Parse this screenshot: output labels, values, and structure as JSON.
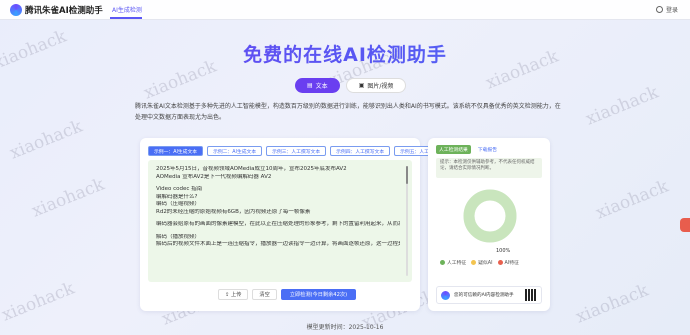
{
  "header": {
    "logo_text": "腾讯朱雀AI检测助手",
    "nav_tab": "AI生成检测",
    "login": "登录"
  },
  "watermark": "xiaohack",
  "page_title": "免费的在线AI检测助手",
  "modes": [
    {
      "label": "文本",
      "active": true
    },
    {
      "label": "图片/视频",
      "active": false
    }
  ],
  "intro": "腾讯朱雀AI文本检测基于多种先进的人工智能模型，构造数百万级别的数据进行训练，能够识别出人类和AI的书写模式。该系统不仅具备优秀的英文检测能力，在处理中文数据方面表现尤为出色。",
  "examples": [
    {
      "label": "示例一：AI生成文本",
      "active": true
    },
    {
      "label": "示例二：AI生成文本",
      "active": false
    },
    {
      "label": "示例三：人工撰写文本",
      "active": false
    },
    {
      "label": "示例四：人工撰写文本",
      "active": false
    },
    {
      "label": "示例五：人工撰写文本",
      "active": false
    }
  ],
  "sample_text": [
    "2025年5月15日，音视频领域AOMedia成立10周年，宣布2025年底发布AV2",
    "AOMedia 宣布AV2是下一代视频编解码器 AV2",
    "",
    "Video codec 指南",
    "编解码器是什么?",
    "编码（压缩视频）",
    "Rd2的未经压缩的原始视频有6GB，因为视频还原了每一帧像素",
    "",
    "编码器会给原有的画面的像素建模型，在此以正在压缩处理的形象参考，剩下的置留利用起来，从而减少存储大小",
    "",
    "解码（播放视频）",
    "解码后的视频文件木面上是一连压缩指令，播放器一边读指令一边计算，将画面逐帧还原，这一过程是解码"
  ],
  "actions": {
    "upload": "上传",
    "clear": "清空",
    "detect": "立即检测(今日剩余42次)"
  },
  "result": {
    "tabs": [
      {
        "label": "人工检测结果",
        "active": true
      },
      {
        "label": "下载报告",
        "active": false
      }
    ],
    "hint": "提示：本检测仅供辅助参考，不代表任何权威结论，请结合实际情况判断。",
    "percent_label": "100%",
    "legend": [
      {
        "label": "人工特征",
        "color": "#6db25a"
      },
      {
        "label": "疑似AI",
        "color": "#f3c450"
      },
      {
        "label": "AI特征",
        "color": "#e8604e"
      }
    ],
    "share": {
      "human": 1.0,
      "suspected": 0.0,
      "ai": 0.0
    },
    "promo": "您的可信赖的AI内容检测助手"
  },
  "model_update": "模型更新时间：2025-10-16",
  "colors": {
    "accent": "#6a3ff0",
    "blue": "#4a6ef5",
    "human": "#6db25a"
  }
}
